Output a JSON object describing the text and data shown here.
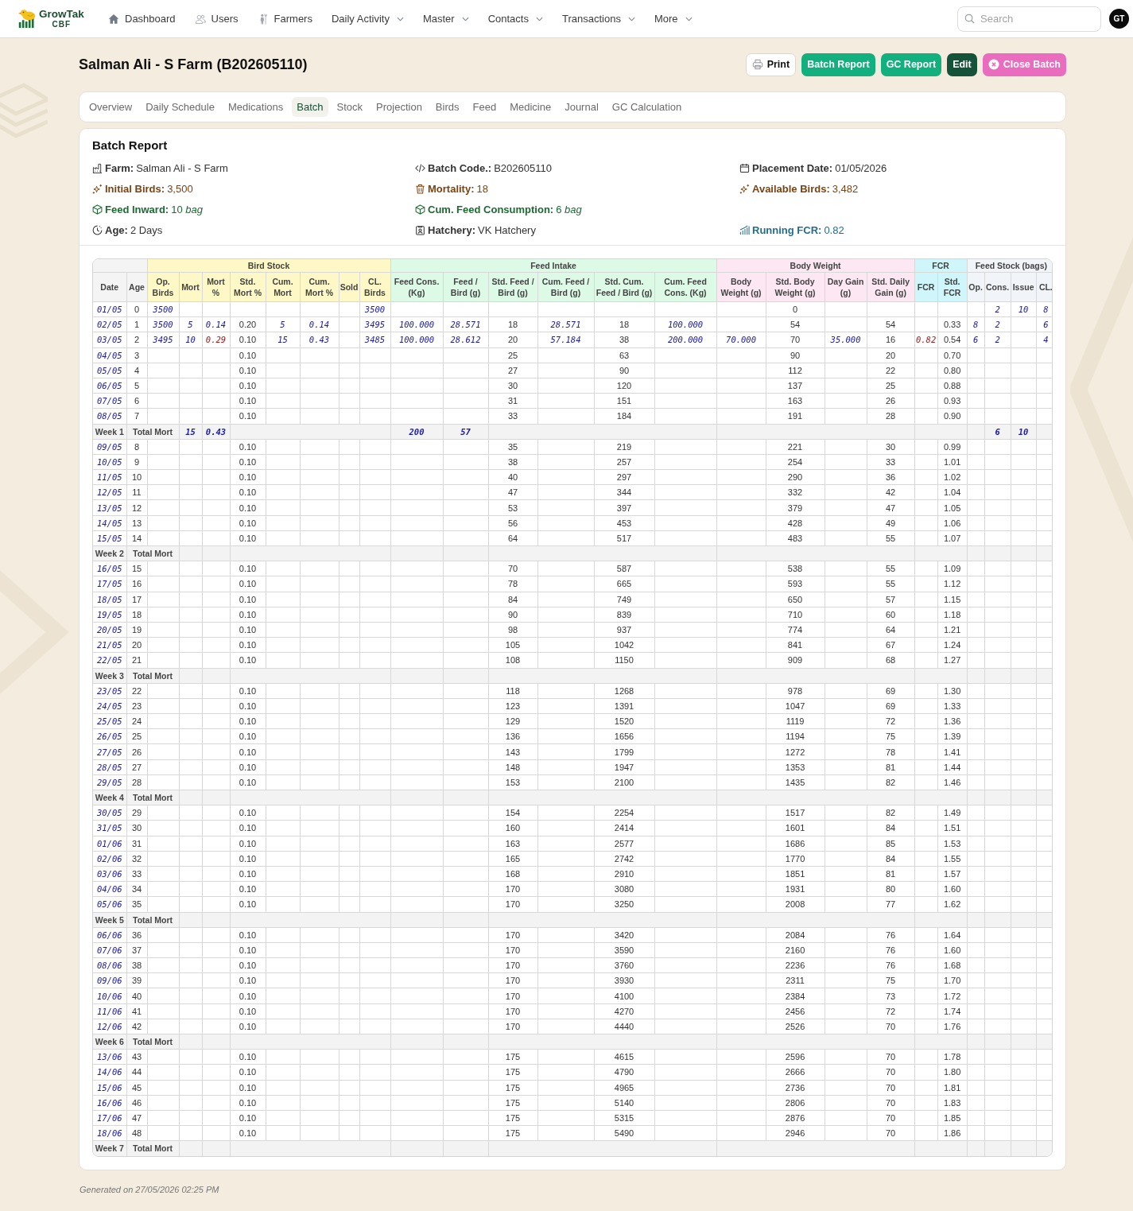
{
  "nav": {
    "logo": {
      "title": "GrowTak",
      "subtitle": "CBF"
    },
    "items": [
      {
        "label": "Dashboard",
        "kind": "link"
      },
      {
        "label": "Users",
        "kind": "link"
      },
      {
        "label": "Farmers",
        "kind": "link"
      },
      {
        "label": "Daily Activity",
        "kind": "menu"
      },
      {
        "label": "Master",
        "kind": "menu"
      },
      {
        "label": "Contacts",
        "kind": "menu"
      },
      {
        "label": "Transactions",
        "kind": "menu"
      },
      {
        "label": "More",
        "kind": "menu"
      }
    ],
    "search": {
      "placeholder": "Search"
    },
    "avatar": "GT"
  },
  "page": {
    "title": "Salman Ali - S Farm (B202605110)",
    "actions": [
      {
        "label": "Print",
        "kind": "print"
      },
      {
        "label": "Batch Report",
        "kind": "primary"
      },
      {
        "label": "GC Report",
        "kind": "primary"
      },
      {
        "label": "Edit",
        "kind": "dark"
      },
      {
        "label": "Close Batch",
        "kind": "close"
      }
    ]
  },
  "tabs": [
    {
      "label": "Overview",
      "selected": false
    },
    {
      "label": "Daily Schedule",
      "selected": false
    },
    {
      "label": "Medications",
      "selected": false
    },
    {
      "label": "Batch",
      "selected": true
    },
    {
      "label": "Stock",
      "selected": false
    },
    {
      "label": "Projection",
      "selected": false
    },
    {
      "label": "Birds",
      "selected": false
    },
    {
      "label": "Feed",
      "selected": false
    },
    {
      "label": "Medicine",
      "selected": false
    },
    {
      "label": "Journal",
      "selected": false
    },
    {
      "label": "GC Calculation",
      "selected": false
    }
  ],
  "report": {
    "title": "Batch Report",
    "info_rows": [
      [
        {
          "label": "Farm:",
          "value": "Salman Ali - S Farm",
          "color": "#333333"
        },
        {
          "label": "Batch Code.:",
          "value": "B202605110",
          "color": "#333333"
        },
        {
          "label": "Placement Date:",
          "value": "01/05/2026",
          "color": "#333333"
        }
      ],
      [
        {
          "label": "Initial Birds:",
          "value": "3,500",
          "color": "#7a4412"
        },
        {
          "label": "Mortality:",
          "value": "18",
          "color": "#7a4412"
        },
        {
          "label": "Available Birds:",
          "value": "3,482",
          "color": "#7a4412"
        }
      ],
      [
        {
          "label": "Feed Inward:",
          "value": "10 *bag*",
          "color": "#1c6b33"
        },
        {
          "label": "Cum. Feed Consumption:",
          "value": "6 *bag*",
          "color": "#1c6b33"
        }
      ],
      [
        {
          "label": "Age:",
          "value": "2 Days",
          "color": "#333333"
        },
        {
          "label": "Hatchery:",
          "value": "VK Hatchery",
          "color": "#333333"
        },
        {
          "label": "Running FCR:",
          "value": "0.82",
          "color": "#1f6e8c"
        }
      ]
    ]
  },
  "table": {
    "groups": [
      {
        "color": "#f4f4f4",
        "columns": [
          {
            "label": "Date",
            "kind": "entry"
          },
          {
            "label": "Age",
            "kind": "plain"
          }
        ]
      },
      {
        "label": "Bird Stock",
        "color": "#fef8c6",
        "columns": [
          {
            "label": "Op. Birds",
            "kind": "entry"
          },
          {
            "label": "Mort",
            "kind": "entry"
          },
          {
            "label": "Mort %",
            "kind": "flagged"
          },
          {
            "label": "Std. Mort %",
            "kind": "plain"
          },
          {
            "label": "Cum. Mort",
            "kind": "entry"
          },
          {
            "label": "Cum. Mort %",
            "kind": "entry"
          },
          {
            "label": "Sold",
            "kind": "entry"
          },
          {
            "label": "CL. Birds",
            "kind": "entry"
          }
        ]
      },
      {
        "label": "Feed Intake",
        "color": "#dcfae6",
        "columns": [
          {
            "label": "Feed Cons. (Kg)",
            "kind": "entry"
          },
          {
            "label": "Feed / Bird (g)",
            "kind": "entry"
          },
          {
            "label": "Std. Feed / Bird (g)",
            "kind": "plain"
          },
          {
            "label": "Cum. Feed / Bird (g)",
            "kind": "entry"
          },
          {
            "label": "Std. Cum. Feed / Bird (g)",
            "kind": "plain"
          },
          {
            "label": "Cum. Feed Cons. (Kg)",
            "kind": "entry"
          }
        ]
      },
      {
        "label": "Body Weight",
        "color": "#fce7f3",
        "columns": [
          {
            "label": "Body Weight (g)",
            "kind": "entry"
          },
          {
            "label": "Std. Body Weight (g)",
            "kind": "plain"
          },
          {
            "label": "Day Gain (g)",
            "kind": "entry"
          },
          {
            "label": "Std. Daily Gain (g)",
            "kind": "plain"
          }
        ]
      },
      {
        "label": "FCR",
        "color": "#cff7fb",
        "columns": [
          {
            "label": "FCR",
            "kind": "flagged"
          },
          {
            "label": "Std. FCR",
            "kind": "plain"
          }
        ]
      },
      {
        "label": "Feed Stock (bags)",
        "color": "#f1f4f8",
        "columns": [
          {
            "label": "Op.",
            "kind": "entry"
          },
          {
            "label": "Cons.",
            "kind": "entry"
          },
          {
            "label": "Issue",
            "kind": "entry"
          },
          {
            "label": "CL.",
            "kind": "entry"
          }
        ]
      }
    ],
    "rows": [
      {
        "kind": "day",
        "cells": [
          "01/05",
          "0",
          "3500",
          null,
          null,
          null,
          null,
          null,
          null,
          "3500",
          null,
          null,
          null,
          null,
          null,
          null,
          null,
          "0",
          null,
          null,
          null,
          null,
          null,
          "2",
          "10",
          "8"
        ]
      },
      {
        "kind": "day",
        "cells": [
          "02/05",
          "1",
          "3500",
          "5",
          {
            "value": "0.14",
            "alert": false
          },
          "0.20",
          "5",
          "0.14",
          null,
          "3495",
          "100.000",
          "28.571",
          "18",
          "28.571",
          "18",
          "100.000",
          null,
          "54",
          null,
          "54",
          null,
          "0.33",
          "8",
          "2",
          null,
          "6"
        ]
      },
      {
        "kind": "day",
        "cells": [
          "03/05",
          "2",
          "3495",
          "10",
          {
            "value": "0.29",
            "alert": true
          },
          "0.10",
          "15",
          "0.43",
          null,
          "3485",
          "100.000",
          "28.612",
          "20",
          "57.184",
          "38",
          "200.000",
          "70.000",
          "70",
          "35.000",
          "16",
          {
            "value": "0.82",
            "alert": true
          },
          "0.54",
          "6",
          "2",
          null,
          "4"
        ]
      },
      {
        "kind": "day",
        "cells": [
          "04/05",
          "3",
          null,
          null,
          null,
          "0.10",
          null,
          null,
          null,
          null,
          null,
          null,
          "25",
          null,
          "63",
          null,
          null,
          "90",
          null,
          "20",
          null,
          "0.70",
          null,
          null,
          null,
          null
        ]
      },
      {
        "kind": "day",
        "cells": [
          "05/05",
          "4",
          null,
          null,
          null,
          "0.10",
          null,
          null,
          null,
          null,
          null,
          null,
          "27",
          null,
          "90",
          null,
          null,
          "112",
          null,
          "22",
          null,
          "0.80",
          null,
          null,
          null,
          null
        ]
      },
      {
        "kind": "day",
        "cells": [
          "06/05",
          "5",
          null,
          null,
          null,
          "0.10",
          null,
          null,
          null,
          null,
          null,
          null,
          "30",
          null,
          "120",
          null,
          null,
          "137",
          null,
          "25",
          null,
          "0.88",
          null,
          null,
          null,
          null
        ]
      },
      {
        "kind": "day",
        "cells": [
          "07/05",
          "6",
          null,
          null,
          null,
          "0.10",
          null,
          null,
          null,
          null,
          null,
          null,
          "31",
          null,
          "151",
          null,
          null,
          "163",
          null,
          "26",
          null,
          "0.93",
          null,
          null,
          null,
          null
        ]
      },
      {
        "kind": "day",
        "cells": [
          "08/05",
          "7",
          null,
          null,
          null,
          "0.10",
          null,
          null,
          null,
          null,
          null,
          null,
          "33",
          null,
          "184",
          null,
          null,
          "191",
          null,
          "28",
          null,
          "0.90",
          null,
          null,
          null,
          null
        ]
      },
      {
        "kind": "week",
        "label": "Week 1",
        "title": "Total Mort",
        "mort": "15",
        "mort_pct": "0.43",
        "feed_cons": "200",
        "feed_per_bird": "57",
        "stock_cons": "6",
        "stock_issue": "10"
      },
      {
        "kind": "day",
        "cells": [
          "09/05",
          "8",
          null,
          null,
          null,
          "0.10",
          null,
          null,
          null,
          null,
          null,
          null,
          "35",
          null,
          "219",
          null,
          null,
          "221",
          null,
          "30",
          null,
          "0.99",
          null,
          null,
          null,
          null
        ]
      },
      {
        "kind": "day",
        "cells": [
          "10/05",
          "9",
          null,
          null,
          null,
          "0.10",
          null,
          null,
          null,
          null,
          null,
          null,
          "38",
          null,
          "257",
          null,
          null,
          "254",
          null,
          "33",
          null,
          "1.01",
          null,
          null,
          null,
          null
        ]
      },
      {
        "kind": "day",
        "cells": [
          "11/05",
          "10",
          null,
          null,
          null,
          "0.10",
          null,
          null,
          null,
          null,
          null,
          null,
          "40",
          null,
          "297",
          null,
          null,
          "290",
          null,
          "36",
          null,
          "1.02",
          null,
          null,
          null,
          null
        ]
      },
      {
        "kind": "day",
        "cells": [
          "12/05",
          "11",
          null,
          null,
          null,
          "0.10",
          null,
          null,
          null,
          null,
          null,
          null,
          "47",
          null,
          "344",
          null,
          null,
          "332",
          null,
          "42",
          null,
          "1.04",
          null,
          null,
          null,
          null
        ]
      },
      {
        "kind": "day",
        "cells": [
          "13/05",
          "12",
          null,
          null,
          null,
          "0.10",
          null,
          null,
          null,
          null,
          null,
          null,
          "53",
          null,
          "397",
          null,
          null,
          "379",
          null,
          "47",
          null,
          "1.05",
          null,
          null,
          null,
          null
        ]
      },
      {
        "kind": "day",
        "cells": [
          "14/05",
          "13",
          null,
          null,
          null,
          "0.10",
          null,
          null,
          null,
          null,
          null,
          null,
          "56",
          null,
          "453",
          null,
          null,
          "428",
          null,
          "49",
          null,
          "1.06",
          null,
          null,
          null,
          null
        ]
      },
      {
        "kind": "day",
        "cells": [
          "15/05",
          "14",
          null,
          null,
          null,
          "0.10",
          null,
          null,
          null,
          null,
          null,
          null,
          "64",
          null,
          "517",
          null,
          null,
          "483",
          null,
          "55",
          null,
          "1.07",
          null,
          null,
          null,
          null
        ]
      },
      {
        "kind": "week",
        "label": "Week 2",
        "title": "Total Mort"
      },
      {
        "kind": "day",
        "cells": [
          "16/05",
          "15",
          null,
          null,
          null,
          "0.10",
          null,
          null,
          null,
          null,
          null,
          null,
          "70",
          null,
          "587",
          null,
          null,
          "538",
          null,
          "55",
          null,
          "1.09",
          null,
          null,
          null,
          null
        ]
      },
      {
        "kind": "day",
        "cells": [
          "17/05",
          "16",
          null,
          null,
          null,
          "0.10",
          null,
          null,
          null,
          null,
          null,
          null,
          "78",
          null,
          "665",
          null,
          null,
          "593",
          null,
          "55",
          null,
          "1.12",
          null,
          null,
          null,
          null
        ]
      },
      {
        "kind": "day",
        "cells": [
          "18/05",
          "17",
          null,
          null,
          null,
          "0.10",
          null,
          null,
          null,
          null,
          null,
          null,
          "84",
          null,
          "749",
          null,
          null,
          "650",
          null,
          "57",
          null,
          "1.15",
          null,
          null,
          null,
          null
        ]
      },
      {
        "kind": "day",
        "cells": [
          "19/05",
          "18",
          null,
          null,
          null,
          "0.10",
          null,
          null,
          null,
          null,
          null,
          null,
          "90",
          null,
          "839",
          null,
          null,
          "710",
          null,
          "60",
          null,
          "1.18",
          null,
          null,
          null,
          null
        ]
      },
      {
        "kind": "day",
        "cells": [
          "20/05",
          "19",
          null,
          null,
          null,
          "0.10",
          null,
          null,
          null,
          null,
          null,
          null,
          "98",
          null,
          "937",
          null,
          null,
          "774",
          null,
          "64",
          null,
          "1.21",
          null,
          null,
          null,
          null
        ]
      },
      {
        "kind": "day",
        "cells": [
          "21/05",
          "20",
          null,
          null,
          null,
          "0.10",
          null,
          null,
          null,
          null,
          null,
          null,
          "105",
          null,
          "1042",
          null,
          null,
          "841",
          null,
          "67",
          null,
          "1.24",
          null,
          null,
          null,
          null
        ]
      },
      {
        "kind": "day",
        "cells": [
          "22/05",
          "21",
          null,
          null,
          null,
          "0.10",
          null,
          null,
          null,
          null,
          null,
          null,
          "108",
          null,
          "1150",
          null,
          null,
          "909",
          null,
          "68",
          null,
          "1.27",
          null,
          null,
          null,
          null
        ]
      },
      {
        "kind": "week",
        "label": "Week 3",
        "title": "Total Mort"
      },
      {
        "kind": "day",
        "cells": [
          "23/05",
          "22",
          null,
          null,
          null,
          "0.10",
          null,
          null,
          null,
          null,
          null,
          null,
          "118",
          null,
          "1268",
          null,
          null,
          "978",
          null,
          "69",
          null,
          "1.30",
          null,
          null,
          null,
          null
        ]
      },
      {
        "kind": "day",
        "cells": [
          "24/05",
          "23",
          null,
          null,
          null,
          "0.10",
          null,
          null,
          null,
          null,
          null,
          null,
          "123",
          null,
          "1391",
          null,
          null,
          "1047",
          null,
          "69",
          null,
          "1.33",
          null,
          null,
          null,
          null
        ]
      },
      {
        "kind": "day",
        "cells": [
          "25/05",
          "24",
          null,
          null,
          null,
          "0.10",
          null,
          null,
          null,
          null,
          null,
          null,
          "129",
          null,
          "1520",
          null,
          null,
          "1119",
          null,
          "72",
          null,
          "1.36",
          null,
          null,
          null,
          null
        ]
      },
      {
        "kind": "day",
        "cells": [
          "26/05",
          "25",
          null,
          null,
          null,
          "0.10",
          null,
          null,
          null,
          null,
          null,
          null,
          "136",
          null,
          "1656",
          null,
          null,
          "1194",
          null,
          "75",
          null,
          "1.39",
          null,
          null,
          null,
          null
        ]
      },
      {
        "kind": "day",
        "cells": [
          "27/05",
          "26",
          null,
          null,
          null,
          "0.10",
          null,
          null,
          null,
          null,
          null,
          null,
          "143",
          null,
          "1799",
          null,
          null,
          "1272",
          null,
          "78",
          null,
          "1.41",
          null,
          null,
          null,
          null
        ]
      },
      {
        "kind": "day",
        "cells": [
          "28/05",
          "27",
          null,
          null,
          null,
          "0.10",
          null,
          null,
          null,
          null,
          null,
          null,
          "148",
          null,
          "1947",
          null,
          null,
          "1353",
          null,
          "81",
          null,
          "1.44",
          null,
          null,
          null,
          null
        ]
      },
      {
        "kind": "day",
        "cells": [
          "29/05",
          "28",
          null,
          null,
          null,
          "0.10",
          null,
          null,
          null,
          null,
          null,
          null,
          "153",
          null,
          "2100",
          null,
          null,
          "1435",
          null,
          "82",
          null,
          "1.46",
          null,
          null,
          null,
          null
        ]
      },
      {
        "kind": "week",
        "label": "Week 4",
        "title": "Total Mort"
      },
      {
        "kind": "day",
        "cells": [
          "30/05",
          "29",
          null,
          null,
          null,
          "0.10",
          null,
          null,
          null,
          null,
          null,
          null,
          "154",
          null,
          "2254",
          null,
          null,
          "1517",
          null,
          "82",
          null,
          "1.49",
          null,
          null,
          null,
          null
        ]
      },
      {
        "kind": "day",
        "cells": [
          "31/05",
          "30",
          null,
          null,
          null,
          "0.10",
          null,
          null,
          null,
          null,
          null,
          null,
          "160",
          null,
          "2414",
          null,
          null,
          "1601",
          null,
          "84",
          null,
          "1.51",
          null,
          null,
          null,
          null
        ]
      },
      {
        "kind": "day",
        "cells": [
          "01/06",
          "31",
          null,
          null,
          null,
          "0.10",
          null,
          null,
          null,
          null,
          null,
          null,
          "163",
          null,
          "2577",
          null,
          null,
          "1686",
          null,
          "85",
          null,
          "1.53",
          null,
          null,
          null,
          null
        ]
      },
      {
        "kind": "day",
        "cells": [
          "02/06",
          "32",
          null,
          null,
          null,
          "0.10",
          null,
          null,
          null,
          null,
          null,
          null,
          "165",
          null,
          "2742",
          null,
          null,
          "1770",
          null,
          "84",
          null,
          "1.55",
          null,
          null,
          null,
          null
        ]
      },
      {
        "kind": "day",
        "cells": [
          "03/06",
          "33",
          null,
          null,
          null,
          "0.10",
          null,
          null,
          null,
          null,
          null,
          null,
          "168",
          null,
          "2910",
          null,
          null,
          "1851",
          null,
          "81",
          null,
          "1.57",
          null,
          null,
          null,
          null
        ]
      },
      {
        "kind": "day",
        "cells": [
          "04/06",
          "34",
          null,
          null,
          null,
          "0.10",
          null,
          null,
          null,
          null,
          null,
          null,
          "170",
          null,
          "3080",
          null,
          null,
          "1931",
          null,
          "80",
          null,
          "1.60",
          null,
          null,
          null,
          null
        ]
      },
      {
        "kind": "day",
        "cells": [
          "05/06",
          "35",
          null,
          null,
          null,
          "0.10",
          null,
          null,
          null,
          null,
          null,
          null,
          "170",
          null,
          "3250",
          null,
          null,
          "2008",
          null,
          "77",
          null,
          "1.62",
          null,
          null,
          null,
          null
        ]
      },
      {
        "kind": "week",
        "label": "Week 5",
        "title": "Total Mort"
      },
      {
        "kind": "day",
        "cells": [
          "06/06",
          "36",
          null,
          null,
          null,
          "0.10",
          null,
          null,
          null,
          null,
          null,
          null,
          "170",
          null,
          "3420",
          null,
          null,
          "2084",
          null,
          "76",
          null,
          "1.64",
          null,
          null,
          null,
          null
        ]
      },
      {
        "kind": "day",
        "cells": [
          "07/06",
          "37",
          null,
          null,
          null,
          "0.10",
          null,
          null,
          null,
          null,
          null,
          null,
          "170",
          null,
          "3590",
          null,
          null,
          "2160",
          null,
          "76",
          null,
          "1.60",
          null,
          null,
          null,
          null
        ]
      },
      {
        "kind": "day",
        "cells": [
          "08/06",
          "38",
          null,
          null,
          null,
          "0.10",
          null,
          null,
          null,
          null,
          null,
          null,
          "170",
          null,
          "3760",
          null,
          null,
          "2236",
          null,
          "76",
          null,
          "1.68",
          null,
          null,
          null,
          null
        ]
      },
      {
        "kind": "day",
        "cells": [
          "09/06",
          "39",
          null,
          null,
          null,
          "0.10",
          null,
          null,
          null,
          null,
          null,
          null,
          "170",
          null,
          "3930",
          null,
          null,
          "2311",
          null,
          "75",
          null,
          "1.70",
          null,
          null,
          null,
          null
        ]
      },
      {
        "kind": "day",
        "cells": [
          "10/06",
          "40",
          null,
          null,
          null,
          "0.10",
          null,
          null,
          null,
          null,
          null,
          null,
          "170",
          null,
          "4100",
          null,
          null,
          "2384",
          null,
          "73",
          null,
          "1.72",
          null,
          null,
          null,
          null
        ]
      },
      {
        "kind": "day",
        "cells": [
          "11/06",
          "41",
          null,
          null,
          null,
          "0.10",
          null,
          null,
          null,
          null,
          null,
          null,
          "170",
          null,
          "4270",
          null,
          null,
          "2456",
          null,
          "72",
          null,
          "1.74",
          null,
          null,
          null,
          null
        ]
      },
      {
        "kind": "day",
        "cells": [
          "12/06",
          "42",
          null,
          null,
          null,
          "0.10",
          null,
          null,
          null,
          null,
          null,
          null,
          "170",
          null,
          "4440",
          null,
          null,
          "2526",
          null,
          "70",
          null,
          "1.76",
          null,
          null,
          null,
          null
        ]
      },
      {
        "kind": "week",
        "label": "Week 6",
        "title": "Total Mort"
      },
      {
        "kind": "day",
        "cells": [
          "13/06",
          "43",
          null,
          null,
          null,
          "0.10",
          null,
          null,
          null,
          null,
          null,
          null,
          "175",
          null,
          "4615",
          null,
          null,
          "2596",
          null,
          "70",
          null,
          "1.78",
          null,
          null,
          null,
          null
        ]
      },
      {
        "kind": "day",
        "cells": [
          "14/06",
          "44",
          null,
          null,
          null,
          "0.10",
          null,
          null,
          null,
          null,
          null,
          null,
          "175",
          null,
          "4790",
          null,
          null,
          "2666",
          null,
          "70",
          null,
          "1.80",
          null,
          null,
          null,
          null
        ]
      },
      {
        "kind": "day",
        "cells": [
          "15/06",
          "45",
          null,
          null,
          null,
          "0.10",
          null,
          null,
          null,
          null,
          null,
          null,
          "175",
          null,
          "4965",
          null,
          null,
          "2736",
          null,
          "70",
          null,
          "1.81",
          null,
          null,
          null,
          null
        ]
      },
      {
        "kind": "day",
        "cells": [
          "16/06",
          "46",
          null,
          null,
          null,
          "0.10",
          null,
          null,
          null,
          null,
          null,
          null,
          "175",
          null,
          "5140",
          null,
          null,
          "2806",
          null,
          "70",
          null,
          "1.83",
          null,
          null,
          null,
          null
        ]
      },
      {
        "kind": "day",
        "cells": [
          "17/06",
          "47",
          null,
          null,
          null,
          "0.10",
          null,
          null,
          null,
          null,
          null,
          null,
          "175",
          null,
          "5315",
          null,
          null,
          "2876",
          null,
          "70",
          null,
          "1.85",
          null,
          null,
          null,
          null
        ]
      },
      {
        "kind": "day",
        "cells": [
          "18/06",
          "48",
          null,
          null,
          null,
          "0.10",
          null,
          null,
          null,
          null,
          null,
          null,
          "175",
          null,
          "5490",
          null,
          null,
          "2946",
          null,
          "70",
          null,
          "1.86",
          null,
          null,
          null,
          null
        ]
      },
      {
        "kind": "week",
        "label": "Week 7",
        "title": "Total Mort"
      }
    ]
  },
  "footer": "Generated on 27/05/2026 02:25 PM"
}
